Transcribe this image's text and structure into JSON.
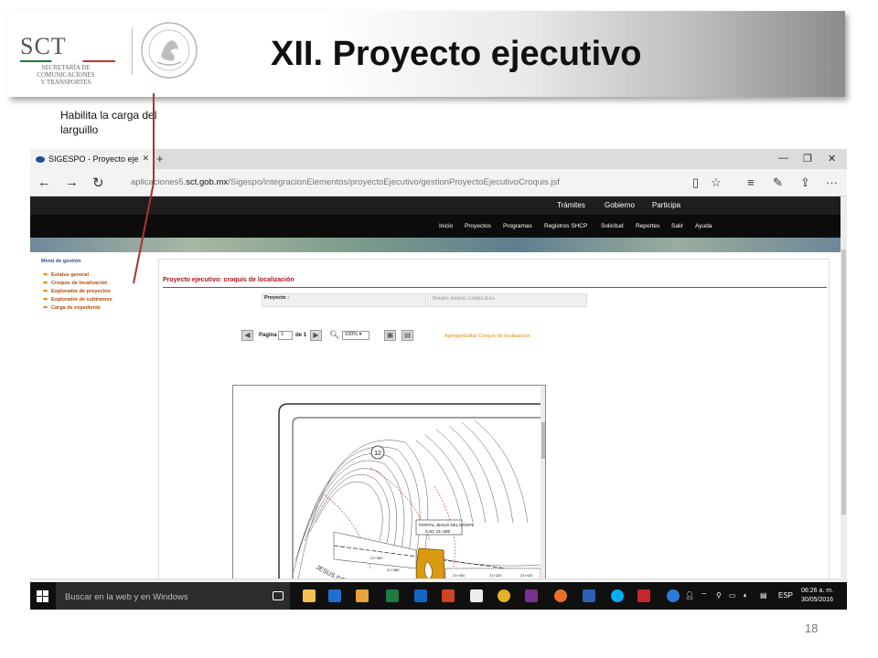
{
  "slide": {
    "title": "XII. Proyecto ejecutivo",
    "note": "Habilita la carga del larguillo",
    "page_number": "18"
  },
  "logo": {
    "abbr": "SCT",
    "line1": "SECRETARÍA DE",
    "line2": "COMUNICACIONES",
    "line3": "Y TRANSPORTES"
  },
  "browser": {
    "tab_title": "SIGESPO - Proyecto eje",
    "url_prefix": "aplicaciones5.",
    "url_domain": "sct.gob.mx",
    "url_path": "/Sigespo/integracionElementos/proyectoEjecutivo/gestionProyectoEjecutivoCroquis.jsf"
  },
  "site": {
    "top_menu": [
      "Trámites",
      "Gobierno",
      "Participa"
    ],
    "main_menu": [
      "Inicio",
      "Proyectos",
      "Programas",
      "Registros SHCP",
      "Solicitud",
      "Reportes",
      "Salir",
      "Ayuda"
    ],
    "sidebar_title": "Menú de gestión",
    "sidebar_items": [
      "Estatus general",
      "Croquis de localización",
      "Explorador de proyectos",
      "Explorador de subtramos",
      "Carga de expediente"
    ],
    "page_title": "Proyecto ejecutivo: croquis de localización",
    "project_label": "Proyecto :",
    "project_value": "TRAMO: RAMAL CAMELINAS",
    "pdf_page_label": "Pagina",
    "pdf_page_value": "1",
    "pdf_page_of": "de 1",
    "pdf_zoom": "100%",
    "edit_link": "Agregar/Editar Croquis de localización"
  },
  "drawing": {
    "marker": "12",
    "portal_label1": "PORTAL JESUS DEL MONTE",
    "portal_label2": "CAD. 21+390",
    "road_label": "JESUS DEL MONTE",
    "stations": [
      "21+360",
      "21+380",
      "21+400",
      "21+420",
      "21+440"
    ],
    "fill_color": "#d99a0f"
  },
  "taskbar": {
    "search_placeholder": "Buscar en la web y en Windows",
    "language": "ESP",
    "time": "06:26 a. m.",
    "date": "30/05/2016"
  }
}
